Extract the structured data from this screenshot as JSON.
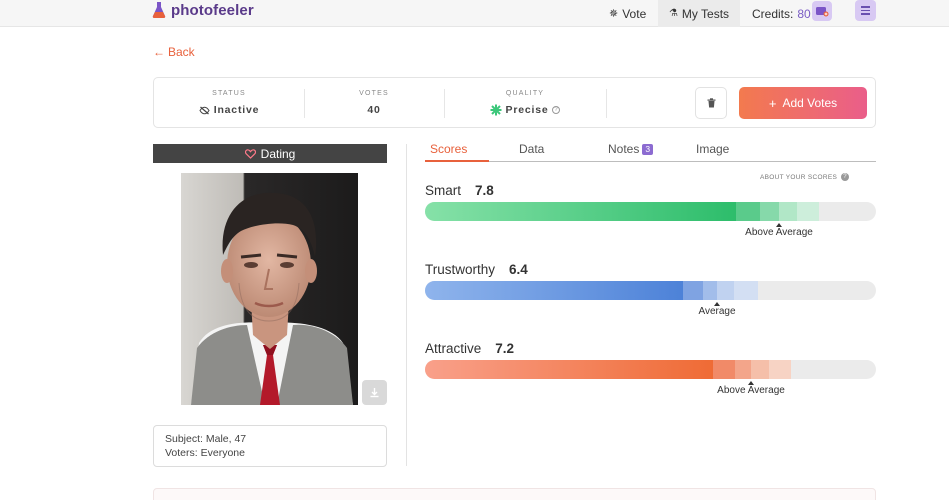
{
  "nav": {
    "logo_text": "photofeeler",
    "vote_label": "Vote",
    "my_tests_label": "My Tests",
    "credits_label": "Credits:",
    "credits_value": "80"
  },
  "back_label": "Back",
  "status_card": {
    "status_label": "STATUS",
    "status_value": "Inactive",
    "votes_label": "VOTES",
    "votes_value": "40",
    "quality_label": "QUALITY",
    "quality_value": "Precise",
    "add_votes_label": "Add Votes"
  },
  "category": "Dating",
  "subject": {
    "subject_text": "Subject: Male, 47",
    "voters_text": "Voters: Everyone"
  },
  "tabs": [
    {
      "label": "Scores"
    },
    {
      "label": "Data"
    },
    {
      "label": "Notes",
      "badge": "3"
    },
    {
      "label": "Image"
    }
  ],
  "about_scores": "ABOUT YOUR SCORES",
  "scores": [
    {
      "label": "Smart",
      "value": "7.8",
      "rating": "Above Average",
      "fraction": 0.78,
      "color": "#3cc77a"
    },
    {
      "label": "Trustworthy",
      "value": "6.4",
      "rating": "Average",
      "fraction": 0.64,
      "color": "#5b8fdc"
    },
    {
      "label": "Attractive",
      "value": "7.2",
      "rating": "Above Average",
      "fraction": 0.72,
      "color": "#f06a3d"
    }
  ],
  "colors": {
    "accent": "#e8613c",
    "brand_purple": "#5a3a8a",
    "badge_purple": "#8c6bd1",
    "dark_bar": "#444444"
  }
}
